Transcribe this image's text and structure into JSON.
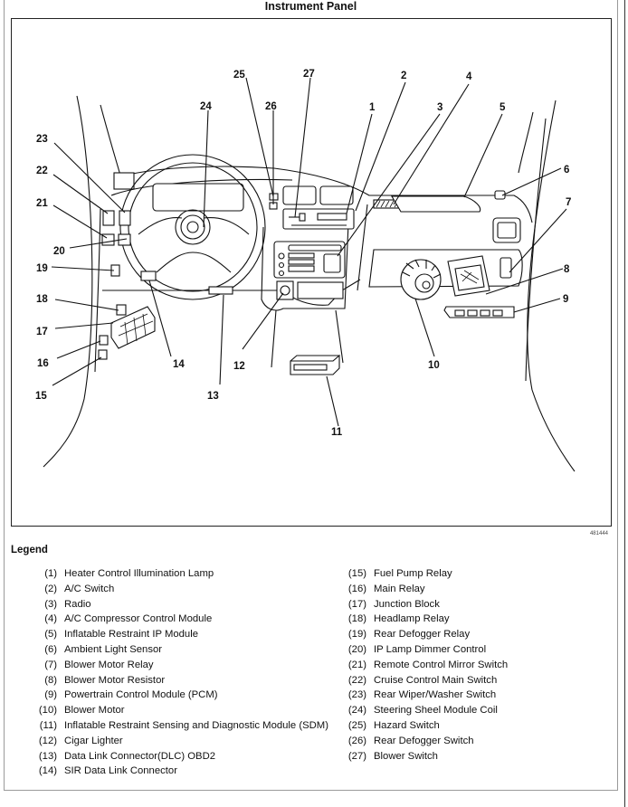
{
  "title": "Instrument Panel",
  "figure_id": "481444",
  "callouts": [
    "1",
    "2",
    "3",
    "4",
    "5",
    "6",
    "7",
    "8",
    "9",
    "10",
    "11",
    "12",
    "13",
    "14",
    "15",
    "16",
    "17",
    "18",
    "19",
    "20",
    "21",
    "22",
    "23",
    "24",
    "25",
    "26",
    "27"
  ],
  "legend": {
    "heading": "Legend",
    "items": [
      {
        "num": "(1)",
        "label": "Heater Control Illumination Lamp"
      },
      {
        "num": "(2)",
        "label": "A/C Switch"
      },
      {
        "num": "(3)",
        "label": "Radio"
      },
      {
        "num": "(4)",
        "label": "A/C Compressor Control Module"
      },
      {
        "num": "(5)",
        "label": "Inflatable Restraint IP Module"
      },
      {
        "num": "(6)",
        "label": "Ambient Light Sensor"
      },
      {
        "num": "(7)",
        "label": "Blower Motor Relay"
      },
      {
        "num": "(8)",
        "label": "Blower Motor Resistor"
      },
      {
        "num": "(9)",
        "label": "Powertrain Control Module (PCM)"
      },
      {
        "num": "(10)",
        "label": "Blower Motor"
      },
      {
        "num": "(11)",
        "label": "Inflatable Restraint Sensing and Diagnostic Module (SDM)"
      },
      {
        "num": "(12)",
        "label": "Cigar Lighter"
      },
      {
        "num": "(13)",
        "label": "Data Link Connector(DLC) OBD2"
      },
      {
        "num": "(14)",
        "label": "SIR Data Link Connector"
      },
      {
        "num": "(15)",
        "label": "Fuel Pump Relay"
      },
      {
        "num": "(16)",
        "label": "Main Relay"
      },
      {
        "num": "(17)",
        "label": "Junction Block"
      },
      {
        "num": "(18)",
        "label": "Headlamp Relay"
      },
      {
        "num": "(19)",
        "label": "Rear Defogger Relay"
      },
      {
        "num": "(20)",
        "label": "IP Lamp Dimmer Control"
      },
      {
        "num": "(21)",
        "label": "Remote Control Mirror Switch"
      },
      {
        "num": "(22)",
        "label": "Cruise Control Main Switch"
      },
      {
        "num": "(23)",
        "label": "Rear Wiper/Washer Switch"
      },
      {
        "num": "(24)",
        "label": "Steering Sheel Module Coil"
      },
      {
        "num": "(25)",
        "label": "Hazard Switch"
      },
      {
        "num": "(26)",
        "label": "Rear Defogger Switch"
      },
      {
        "num": "(27)",
        "label": "Blower Switch"
      }
    ]
  }
}
